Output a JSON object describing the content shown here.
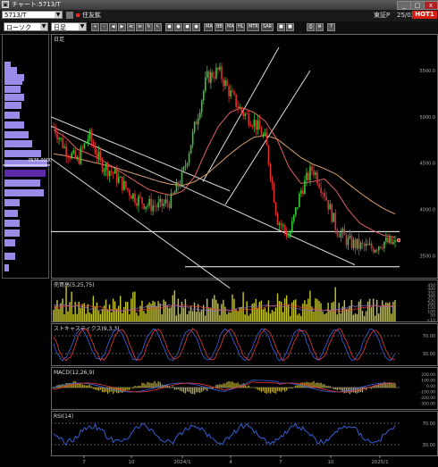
{
  "window": {
    "title": "チャート:5713/T",
    "icon": "chart-window-icon",
    "buttons": [
      "_",
      "□",
      "x"
    ]
  },
  "toolbar2": {
    "code": "5713/T",
    "type": "住友鉱",
    "exchange": "東証P",
    "date": "25/02/03",
    "hot_label": "HOT1"
  },
  "toolbar": {
    "chart_type": "ローソク",
    "period": "日足",
    "ma_buttons": [
      "MA",
      "BB",
      "MA",
      "HL",
      "MTR",
      "SAR"
    ]
  },
  "panels": {
    "price_label": "日足",
    "price_ticks": [
      "5500.0",
      "5000.0",
      "4500.0",
      "4000.0",
      "3500.0"
    ],
    "volume_label": "売買高(5,25,75)",
    "volume_ticks": [
      "450",
      "400",
      "350",
      "300",
      "250",
      "200",
      "150",
      "100",
      "50"
    ],
    "volume_unit": "×10",
    "stoch_label": "ストキャスティクス(9,3,3)",
    "stoch_ticks": [
      "70.00",
      "30.00"
    ],
    "macd_label": "MACD(12,26,9)",
    "macd_ticks": [
      "200.00",
      "100.00",
      "0.00",
      "-100.00",
      "-200.00",
      "-300.00"
    ],
    "rsi_label": "RSI(14)",
    "rsi_ticks": [
      "70.00",
      "30.00"
    ]
  },
  "xaxis": [
    "7",
    "10",
    "2024/1",
    "4",
    "7",
    "10",
    "2025/1"
  ],
  "annotation": "7676.0000",
  "colors": {
    "up": "#38c838",
    "down": "#e03030",
    "price_line": "#ffffff",
    "volume": "#c8c828",
    "volume_down": "#8c6cc8",
    "panel_line_blue": "#3c64e6",
    "panel_line_red": "#e83c3c",
    "rsi_line": "#3c64e6",
    "hot": "#d81f10",
    "profile": "#9b8be8",
    "profile_current": "#5a2aa8",
    "support": "#ffffff"
  },
  "chart_data": {
    "type": "candlestick",
    "title": "日足",
    "x": [
      "7",
      "10",
      "2024/1",
      "4",
      "7",
      "10",
      "2025/1"
    ],
    "ylim": [
      3300,
      5800
    ],
    "series": [
      {
        "points": [
          4900,
          4650,
          4520,
          4800,
          4500,
          4400,
          4250,
          4120,
          4050,
          4030,
          4100,
          4380,
          4900,
          5420,
          5500,
          5250,
          5050,
          4950,
          4750,
          3900,
          3700,
          4200,
          4450,
          4180,
          3800,
          3650,
          3600,
          3580,
          3650,
          3620
        ]
      },
      {
        "values": [
          4860,
          4780,
          4650,
          4600,
          4540,
          4460,
          4380,
          4300,
          4220,
          4180,
          4150,
          4200,
          4360,
          4650,
          4900,
          5050,
          5100,
          5050,
          4950,
          4750,
          4450,
          4280,
          4300,
          4330,
          4200,
          4000,
          3850,
          3780,
          3720,
          3700
        ]
      },
      {
        "values": [
          4600,
          4580,
          4550,
          4520,
          4490,
          4460,
          4420,
          4380,
          4340,
          4300,
          4270,
          4260,
          4300,
          4380,
          4490,
          4600,
          4700,
          4780,
          4800,
          4760,
          4660,
          4560,
          4490,
          4440,
          4380,
          4280,
          4180,
          4090,
          4010,
          3950
        ]
      }
    ],
    "support_lines": [
      3760,
      3380
    ]
  }
}
